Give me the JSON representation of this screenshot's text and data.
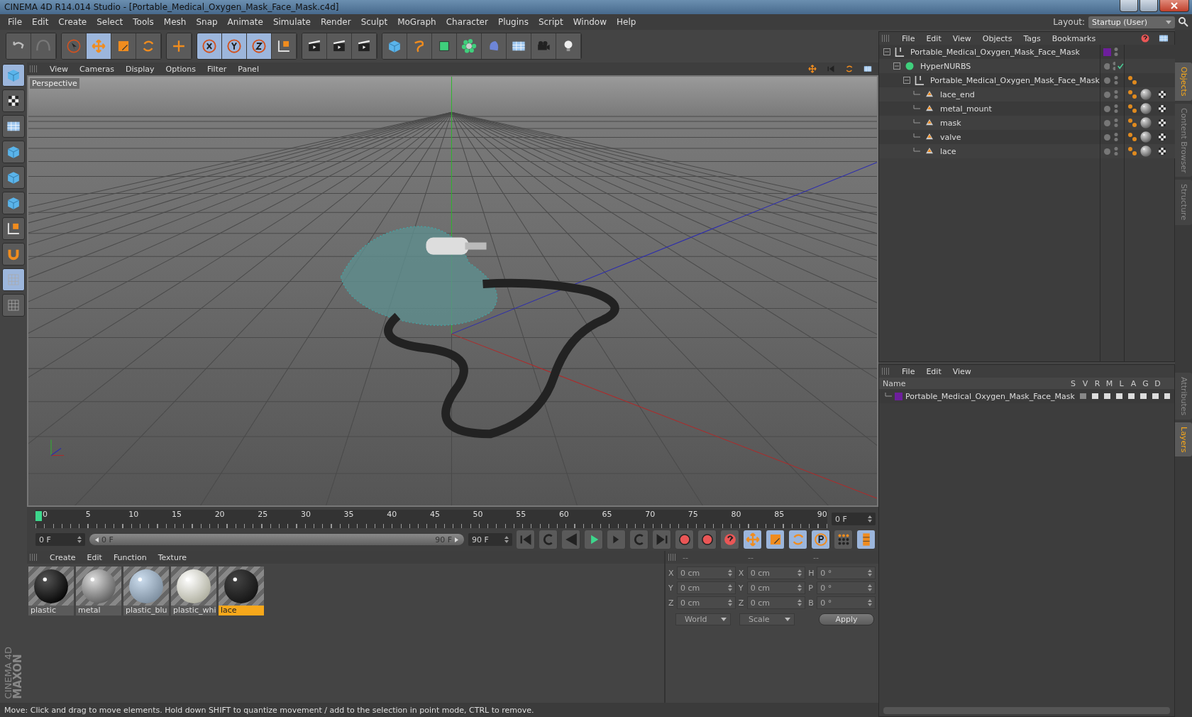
{
  "window": {
    "title": "CINEMA 4D R14.014 Studio - [Portable_Medical_Oxygen_Mask_Face_Mask.c4d]"
  },
  "menu": [
    "File",
    "Edit",
    "Create",
    "Select",
    "Tools",
    "Mesh",
    "Snap",
    "Animate",
    "Simulate",
    "Render",
    "Sculpt",
    "MoGraph",
    "Character",
    "Plugins",
    "Script",
    "Window",
    "Help"
  ],
  "layout": {
    "label": "Layout:",
    "value": "Startup (User)"
  },
  "viewport": {
    "menu": [
      "View",
      "Cameras",
      "Display",
      "Options",
      "Filter",
      "Panel"
    ],
    "label": "Perspective"
  },
  "timeline": {
    "ticks": [
      "0",
      "5",
      "10",
      "15",
      "20",
      "25",
      "30",
      "35",
      "40",
      "45",
      "50",
      "55",
      "60",
      "65",
      "70",
      "75",
      "80",
      "85",
      "90"
    ],
    "current": "0 F",
    "start": "0 F",
    "range": {
      "start": "0 F",
      "end": "90 F",
      "level": 1
    },
    "end": "90 F"
  },
  "materials": {
    "menu": [
      "Create",
      "Edit",
      "Function",
      "Texture"
    ],
    "items": [
      {
        "name": "plastic",
        "kind": "black",
        "selected": false
      },
      {
        "name": "metal",
        "kind": "metal",
        "selected": false
      },
      {
        "name": "plastic_blu",
        "kind": "clear",
        "selected": false
      },
      {
        "name": "plastic_whi",
        "kind": "white",
        "selected": false
      },
      {
        "name": "lace",
        "kind": "dark",
        "selected": true
      }
    ]
  },
  "coordinates": {
    "headers": [
      "--",
      "--",
      "--"
    ],
    "columns": [
      [
        {
          "axis": "X",
          "value": "0 cm"
        },
        {
          "axis": "Y",
          "value": "0 cm"
        },
        {
          "axis": "Z",
          "value": "0 cm"
        }
      ],
      [
        {
          "axis": "X",
          "value": "0 cm"
        },
        {
          "axis": "Y",
          "value": "0 cm"
        },
        {
          "axis": "Z",
          "value": "0 cm"
        }
      ],
      [
        {
          "axis": "H",
          "value": "0 °"
        },
        {
          "axis": "P",
          "value": "0 °"
        },
        {
          "axis": "B",
          "value": "0 °"
        }
      ]
    ],
    "dropdowns": [
      "World",
      "Scale"
    ],
    "apply": "Apply"
  },
  "objects": {
    "menu": [
      "File",
      "Edit",
      "View",
      "Objects",
      "Tags",
      "Bookmarks"
    ],
    "tree": [
      {
        "name": "Portable_Medical_Oxygen_Mask_Face_Mask",
        "kind": "null",
        "color": "#6d1f9c",
        "enabled_check": false,
        "children": [
          {
            "name": "HyperNURBS",
            "kind": "nurbs",
            "enabled_check": true,
            "children": [
              {
                "name": "Portable_Medical_Oxygen_Mask_Face_Mask",
                "kind": "null",
                "enabled_check": false,
                "children": [
                  {
                    "name": "lace_end",
                    "kind": "polygon",
                    "enabled_check": false
                  },
                  {
                    "name": "metal_mount",
                    "kind": "polygon",
                    "enabled_check": false
                  },
                  {
                    "name": "mask",
                    "kind": "polygon",
                    "enabled_check": false
                  },
                  {
                    "name": "valve",
                    "kind": "polygon",
                    "enabled_check": false
                  },
                  {
                    "name": "lace",
                    "kind": "polygon",
                    "enabled_check": false
                  }
                ]
              }
            ]
          }
        ]
      }
    ]
  },
  "layers": {
    "menu": [
      "File",
      "Edit",
      "View"
    ],
    "columns": [
      "Name",
      "S",
      "V",
      "R",
      "M",
      "L",
      "A",
      "G",
      "D"
    ],
    "rows": [
      {
        "name": "Portable_Medical_Oxygen_Mask_Face_Mask",
        "color": "#6d1f9c"
      }
    ]
  },
  "side_tabs": [
    {
      "label": "Objects",
      "selected": true
    },
    {
      "label": "Content Browser",
      "selected": false
    },
    {
      "label": "Structure",
      "selected": false
    }
  ],
  "lower_side_tabs": [
    {
      "label": "Attributes",
      "selected": false
    },
    {
      "label": "Layers",
      "selected": true
    }
  ],
  "branding": [
    "MAXON",
    "CINEMA 4D"
  ],
  "status_bar": "Move: Click and drag to move elements. Hold down SHIFT to quantize movement / add to the selection in point mode, CTRL to remove."
}
